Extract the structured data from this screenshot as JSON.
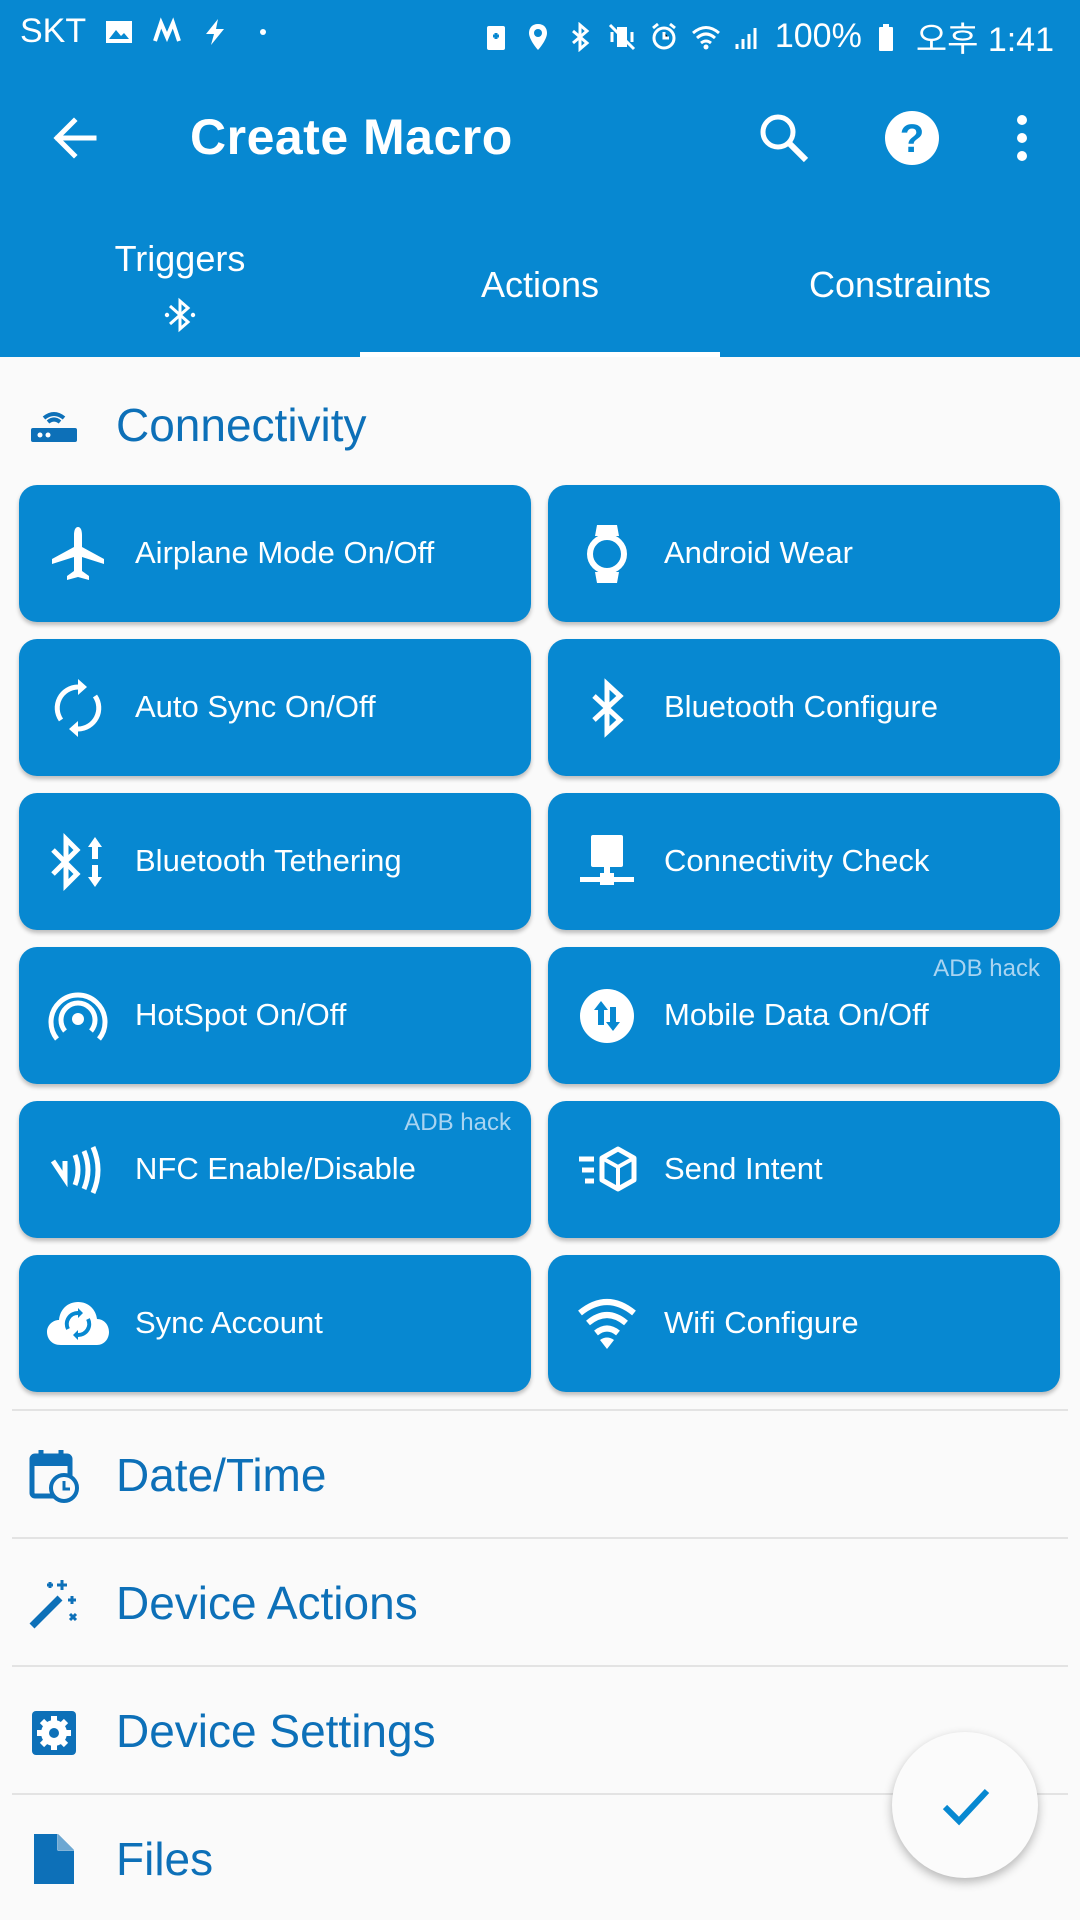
{
  "status_bar": {
    "carrier": "SKT",
    "battery": "100%",
    "time": "오후 1:41"
  },
  "toolbar": {
    "title": "Create Macro",
    "back_icon": "arrow-back-icon",
    "search_icon": "search-icon",
    "help_icon": "help-circle-icon",
    "more_icon": "more-vert-icon"
  },
  "tabs": [
    {
      "label": "Triggers",
      "icon": "bluetooth-icon"
    },
    {
      "label": "Actions",
      "selected": true
    },
    {
      "label": "Constraints"
    }
  ],
  "connectivity": {
    "title": "Connectivity",
    "icon": "router-icon",
    "tiles": [
      {
        "label": "Airplane Mode On/Off",
        "icon": "airplane-icon",
        "badge": ""
      },
      {
        "label": "Android Wear",
        "icon": "watch-icon",
        "badge": ""
      },
      {
        "label": "Auto Sync On/Off",
        "icon": "sync-icon",
        "badge": ""
      },
      {
        "label": "Bluetooth Configure",
        "icon": "bluetooth-icon",
        "badge": ""
      },
      {
        "label": "Bluetooth Tethering",
        "icon": "bluetooth-tethering-icon",
        "badge": ""
      },
      {
        "label": "Connectivity Check",
        "icon": "network-check-icon",
        "badge": ""
      },
      {
        "label": "HotSpot On/Off",
        "icon": "hotspot-icon",
        "badge": ""
      },
      {
        "label": "Mobile Data On/Off",
        "icon": "mobile-data-icon",
        "badge": "ADB hack"
      },
      {
        "label": "NFC Enable/Disable",
        "icon": "nfc-icon",
        "badge": "ADB hack"
      },
      {
        "label": "Send Intent",
        "icon": "send-intent-icon",
        "badge": ""
      },
      {
        "label": "Sync Account",
        "icon": "cloud-sync-icon",
        "badge": ""
      },
      {
        "label": "Wifi Configure",
        "icon": "wifi-icon",
        "badge": ""
      }
    ]
  },
  "categories": [
    {
      "title": "Date/Time",
      "icon": "calendar-clock-icon"
    },
    {
      "title": "Device Actions",
      "icon": "magic-wand-icon"
    },
    {
      "title": "Device Settings",
      "icon": "settings-icon"
    },
    {
      "title": "Files",
      "icon": "file-icon"
    }
  ],
  "fab": {
    "icon": "check-icon"
  },
  "colors": {
    "primary": "#0788d1",
    "section_title": "#0d70b8",
    "background": "#fafafa",
    "badge_text": "#a9d4f1"
  }
}
